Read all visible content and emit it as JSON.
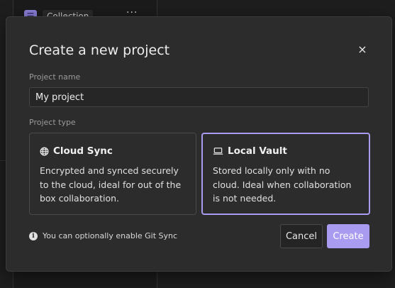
{
  "background": {
    "collection_label": "Collection",
    "collection_icon": "menu-icon",
    "more_glyph": "···"
  },
  "dialog": {
    "title": "Create a new project",
    "close_glyph": "×",
    "name_label": "Project name",
    "name_value": "My project",
    "type_label": "Project type",
    "options": [
      {
        "icon": "globe-icon",
        "title": "Cloud Sync",
        "description": "Encrypted and synced securely to the cloud, ideal for out of the box collaboration.",
        "selected": false
      },
      {
        "icon": "laptop-icon",
        "title": "Local Vault",
        "description": "Stored locally only with no cloud. Ideal when collaboration is not needed.",
        "selected": true
      }
    ],
    "hint": "You can optionally enable Git Sync",
    "hint_icon": "info-icon",
    "cancel_label": "Cancel",
    "create_label": "Create"
  },
  "colors": {
    "accent": "#a99bf0",
    "dialog_bg": "#2c2c2c",
    "page_bg": "#1e1e1e"
  }
}
